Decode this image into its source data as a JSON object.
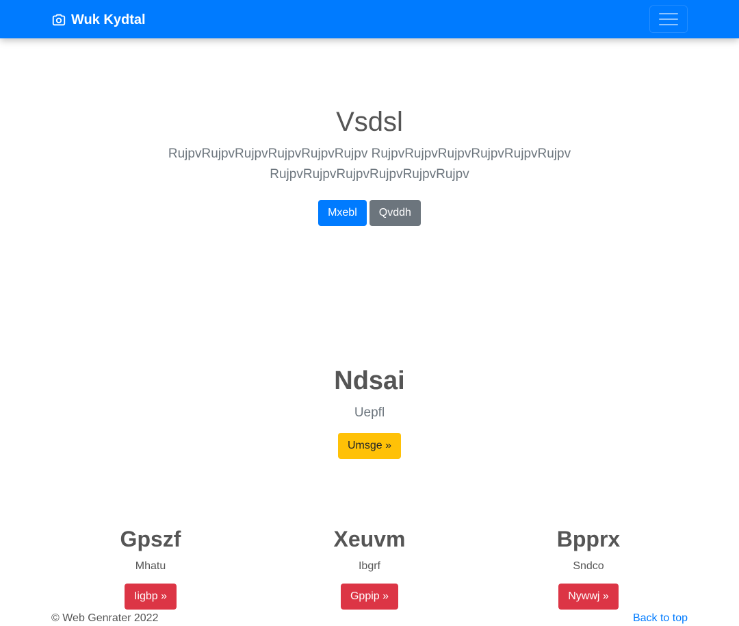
{
  "navbar": {
    "brand_icon": "camera-icon",
    "brand_label": "Wuk Kydtal",
    "toggler_icon": "hamburger-menu-icon",
    "background": "#007bff"
  },
  "hero": {
    "title": "Vsdsl",
    "lead": "RujpvRujpvRujpvRujpvRujpvRujpv RujpvRujpvRujpvRujpvRujpvRujpv RujpvRujpvRujpvRujpvRujpvRujpv",
    "primary_button": "Mxebl",
    "secondary_button": "Qvddh"
  },
  "feature": {
    "title": "Ndsai",
    "subtitle": "Uepfl",
    "button": "Umsge »"
  },
  "columns": [
    {
      "title": "Gpszf",
      "text": "Mhatu",
      "button": "Iigbp »"
    },
    {
      "title": "Xeuvm",
      "text": "Ibgrf",
      "button": "Gppip »"
    },
    {
      "title": "Bpprx",
      "text": "Sndco",
      "button": "Nywwj »"
    }
  ],
  "footer": {
    "copyright": "© Web Genrater 2022",
    "back_to_top": "Back to top"
  },
  "colors": {
    "primary": "#007bff",
    "secondary": "#6c757d",
    "warning": "#ffc107",
    "danger": "#dc3545"
  }
}
